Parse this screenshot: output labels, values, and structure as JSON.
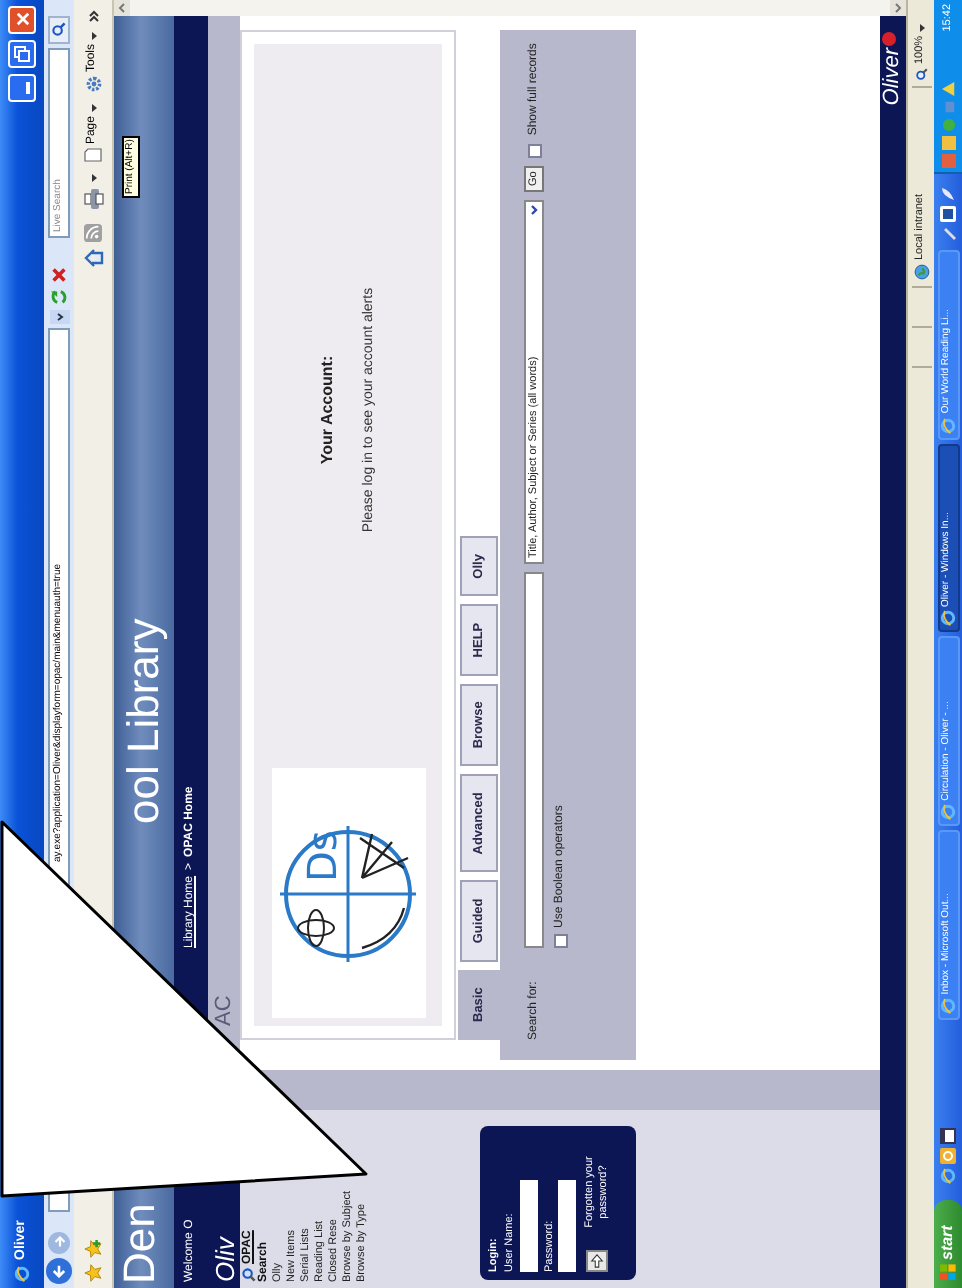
{
  "window": {
    "title": "Oliver"
  },
  "browser": {
    "address": "ay.exe?application=Oliver&displayform=opac/main&menuauth=true",
    "search_placeholder": "Live Search",
    "page_menu": "Page",
    "tools_menu": "Tools",
    "tooltip": "Print (Alt+R)"
  },
  "header": {
    "title_parts": [
      "Den",
      "ool Library"
    ],
    "welcome": "Welcome O",
    "breadcrumb": {
      "link": "Library Home",
      "separator": ">",
      "current": "OPAC Home"
    },
    "section": "AC"
  },
  "sidebar": {
    "logo": "Oliv",
    "opac_link": "OPAC",
    "heading": "Search",
    "items": [
      "Olly",
      "New Items",
      "Serial Lists",
      "Reading List",
      "Closed Rese",
      "Browse by Subject",
      "Browse by Type"
    ]
  },
  "login": {
    "title": "Login:",
    "username_label": "User Name:",
    "password_label": "Password:",
    "forgot": "Forgotten your password?"
  },
  "account": {
    "logo_text": "Ds",
    "heading": "Your Account:",
    "message": "Please log in to see your account alerts"
  },
  "tabs": [
    {
      "label": "Basic",
      "selected": true
    },
    {
      "label": "Guided",
      "selected": false
    },
    {
      "label": "Advanced",
      "selected": false
    },
    {
      "label": "Browse",
      "selected": false
    },
    {
      "label": "HELP",
      "selected": false
    },
    {
      "label": "Olly",
      "selected": false
    }
  ],
  "search": {
    "label": "Search for:",
    "scope": "Title, Author, Subject or Series (all words)",
    "go": "Go",
    "full_records": {
      "label": "Show full records",
      "checked": false
    },
    "boolean": {
      "label": "Use Boolean operators",
      "checked": false
    }
  },
  "footer": {
    "logo": "Oliver"
  },
  "status_bar": {
    "zone": "Local intranet",
    "zoom": "100%"
  },
  "taskbar": {
    "start": "start",
    "tasks": [
      {
        "label": "Inbox - Microsoft Out...",
        "selected": false
      },
      {
        "label": "Circulation - Oliver - ...",
        "selected": false
      },
      {
        "label": "Oliver - Windows In...",
        "selected": true
      },
      {
        "label": "Our World Reading Li...",
        "selected": false
      }
    ],
    "clock": "15:42"
  }
}
